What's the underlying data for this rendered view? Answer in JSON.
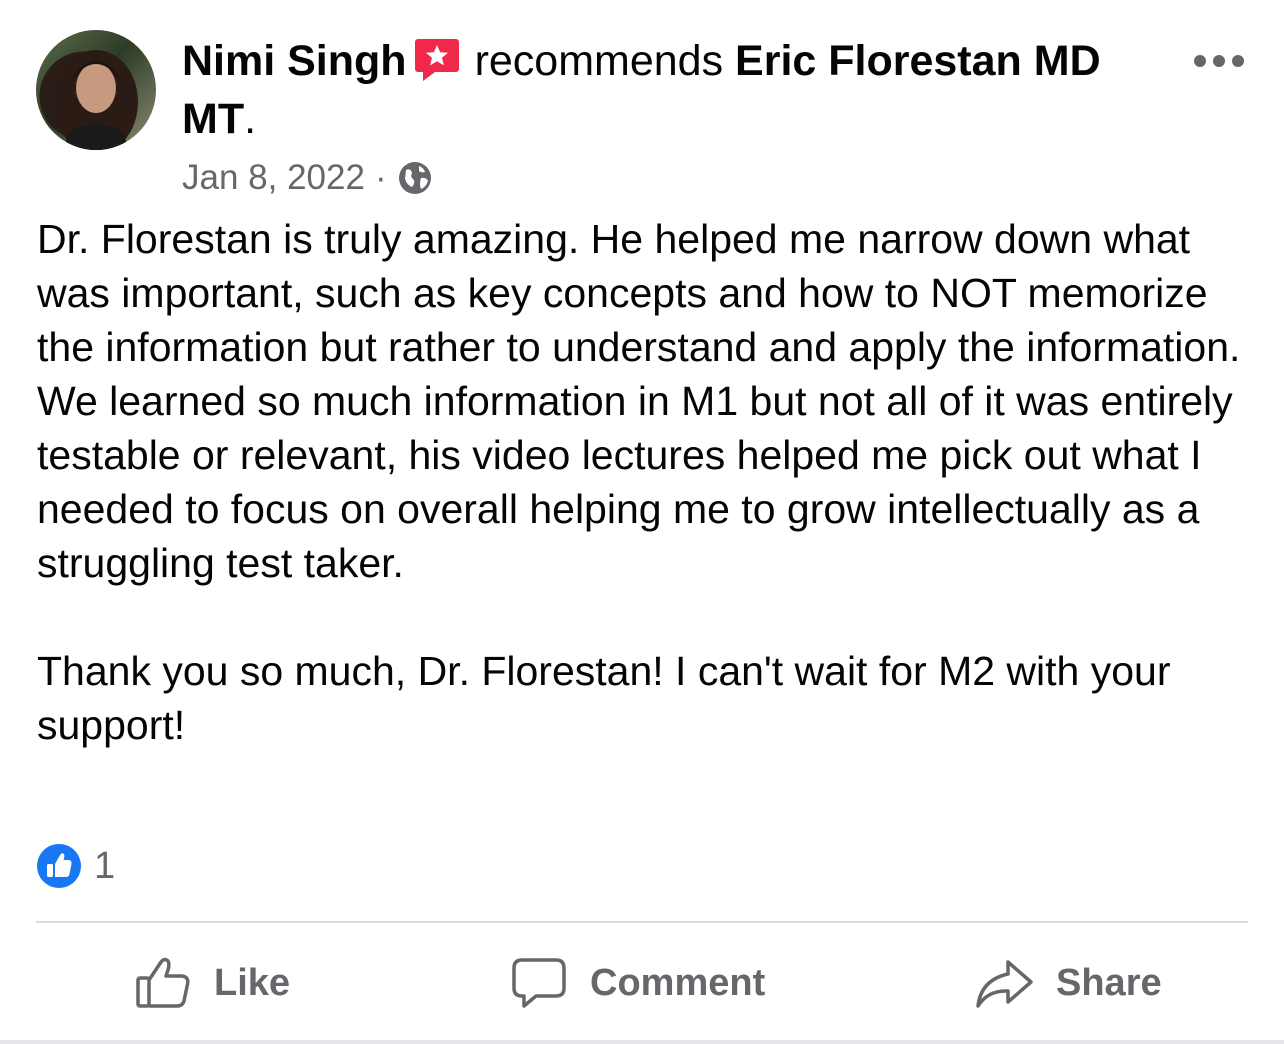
{
  "post": {
    "author": "Nimi Singh",
    "recommend_word": "recommends",
    "page_name": "Eric Florestan MD MT",
    "period": ".",
    "date": "Jan 8, 2022",
    "separator": "·",
    "audience_icon": "globe-icon",
    "paragraphs": [
      "Dr. Florestan is truly amazing. He helped me narrow down what was important, such as key concepts and how to NOT memorize the information but rather to understand and apply the information. We learned so much information in M1 but not all of it was entirely testable or relevant, his video lectures helped me pick out what I needed to focus on overall helping me to grow intellectually as a struggling test taker.",
      "Thank you so much, Dr. Florestan! I can't wait for M2 with your support!"
    ],
    "reaction_count": "1"
  },
  "actions": {
    "like": "Like",
    "comment": "Comment",
    "share": "Share"
  },
  "colors": {
    "recommend_icon": "#f02849",
    "like_blue": "#1877f2",
    "secondary_text": "#65676b"
  }
}
